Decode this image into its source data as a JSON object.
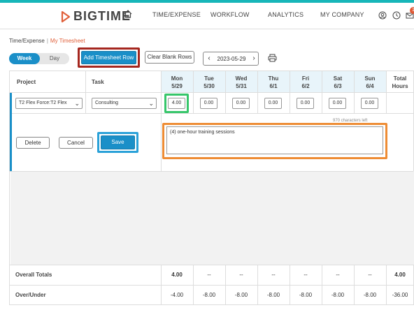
{
  "brand": {
    "name": "BIGTIME",
    "accent": "#17b6b9",
    "primary": "#1a8fc8"
  },
  "nav": {
    "items": [
      "TIME/EXPENSE",
      "WORKFLOW",
      "ANALYTICS",
      "MY COMPANY"
    ],
    "icons": [
      "home-icon",
      "user-icon",
      "clock-icon",
      "mail-icon"
    ],
    "badge": "1"
  },
  "breadcrumb": {
    "parent": "Time/Expense",
    "separator": "|",
    "current": "My Timesheet"
  },
  "toolbar": {
    "view_week": "Week",
    "view_day": "Day",
    "add_row": "Add Timesheet Row",
    "clear_rows": "Clear Blank Rows",
    "date": "2023-05-29",
    "prev": "‹",
    "next": "›"
  },
  "table": {
    "headers": {
      "project": "Project",
      "task": "Task",
      "total": "Total",
      "total_unit": "Hours"
    },
    "days": [
      {
        "name": "Mon",
        "date": "5/29"
      },
      {
        "name": "Tue",
        "date": "5/30"
      },
      {
        "name": "Wed",
        "date": "5/31"
      },
      {
        "name": "Thu",
        "date": "6/1"
      },
      {
        "name": "Fri",
        "date": "6/2"
      },
      {
        "name": "Sat",
        "date": "6/3"
      },
      {
        "name": "Sun",
        "date": "6/4"
      }
    ],
    "row": {
      "project": "T2 Flex Force:T2 Flex",
      "task": "Consulting",
      "hours": [
        "4.00",
        "0.00",
        "0.00",
        "0.00",
        "0.00",
        "0.00",
        "0.00"
      ]
    },
    "editor": {
      "chars_left": "970 characters left",
      "note": "(4) one-hour training sessions",
      "delete": "Delete",
      "cancel": "Cancel",
      "save": "Save"
    },
    "overall": {
      "label": "Overall Totals",
      "values": [
        "4.00",
        "--",
        "--",
        "--",
        "--",
        "--",
        "--",
        "4.00"
      ]
    },
    "over_under": {
      "label": "Over/Under",
      "values": [
        "-4.00",
        "-8.00",
        "-8.00",
        "-8.00",
        "-8.00",
        "-8.00",
        "-8.00",
        "-36.00"
      ]
    }
  }
}
